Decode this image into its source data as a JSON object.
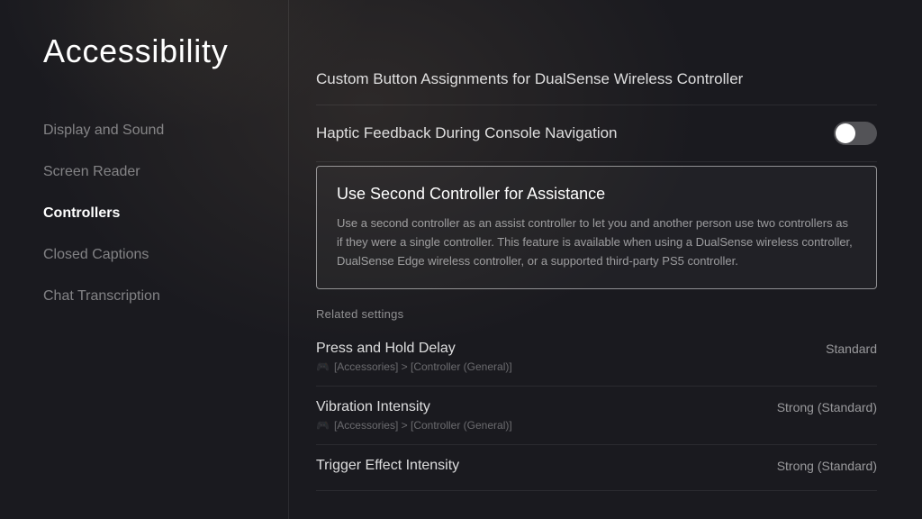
{
  "page": {
    "title": "Accessibility"
  },
  "sidebar": {
    "items": [
      {
        "id": "display-and-sound",
        "label": "Display and Sound",
        "active": false
      },
      {
        "id": "screen-reader",
        "label": "Screen Reader",
        "active": false
      },
      {
        "id": "controllers",
        "label": "Controllers",
        "active": true
      },
      {
        "id": "closed-captions",
        "label": "Closed Captions",
        "active": false
      },
      {
        "id": "chat-transcription",
        "label": "Chat Transcription",
        "active": false
      }
    ]
  },
  "main": {
    "settings": [
      {
        "id": "custom-button",
        "label": "Custom Button Assignments for DualSense Wireless Controller",
        "has_toggle": false,
        "toggle_on": false
      },
      {
        "id": "haptic-feedback",
        "label": "Haptic Feedback During Console Navigation",
        "has_toggle": true,
        "toggle_on": false
      }
    ],
    "highlight_item": {
      "title": "Use Second Controller for Assistance",
      "description": "Use a second controller as an assist controller to let you and another person use two controllers as if they were a single controller. This feature is available when using a DualSense wireless controller, DualSense Edge wireless controller, or a supported third-party PS5 controller."
    },
    "related_settings_label": "Related settings",
    "related_settings": [
      {
        "id": "press-hold-delay",
        "name": "Press and Hold Delay",
        "value": "Standard",
        "path": "[Accessories] > [Controller (General)]"
      },
      {
        "id": "vibration-intensity",
        "name": "Vibration Intensity",
        "value": "Strong (Standard)",
        "path": "[Accessories] > [Controller (General)]"
      },
      {
        "id": "trigger-effect-intensity",
        "name": "Trigger Effect Intensity",
        "value": "Strong (Standard)",
        "path": ""
      }
    ]
  }
}
